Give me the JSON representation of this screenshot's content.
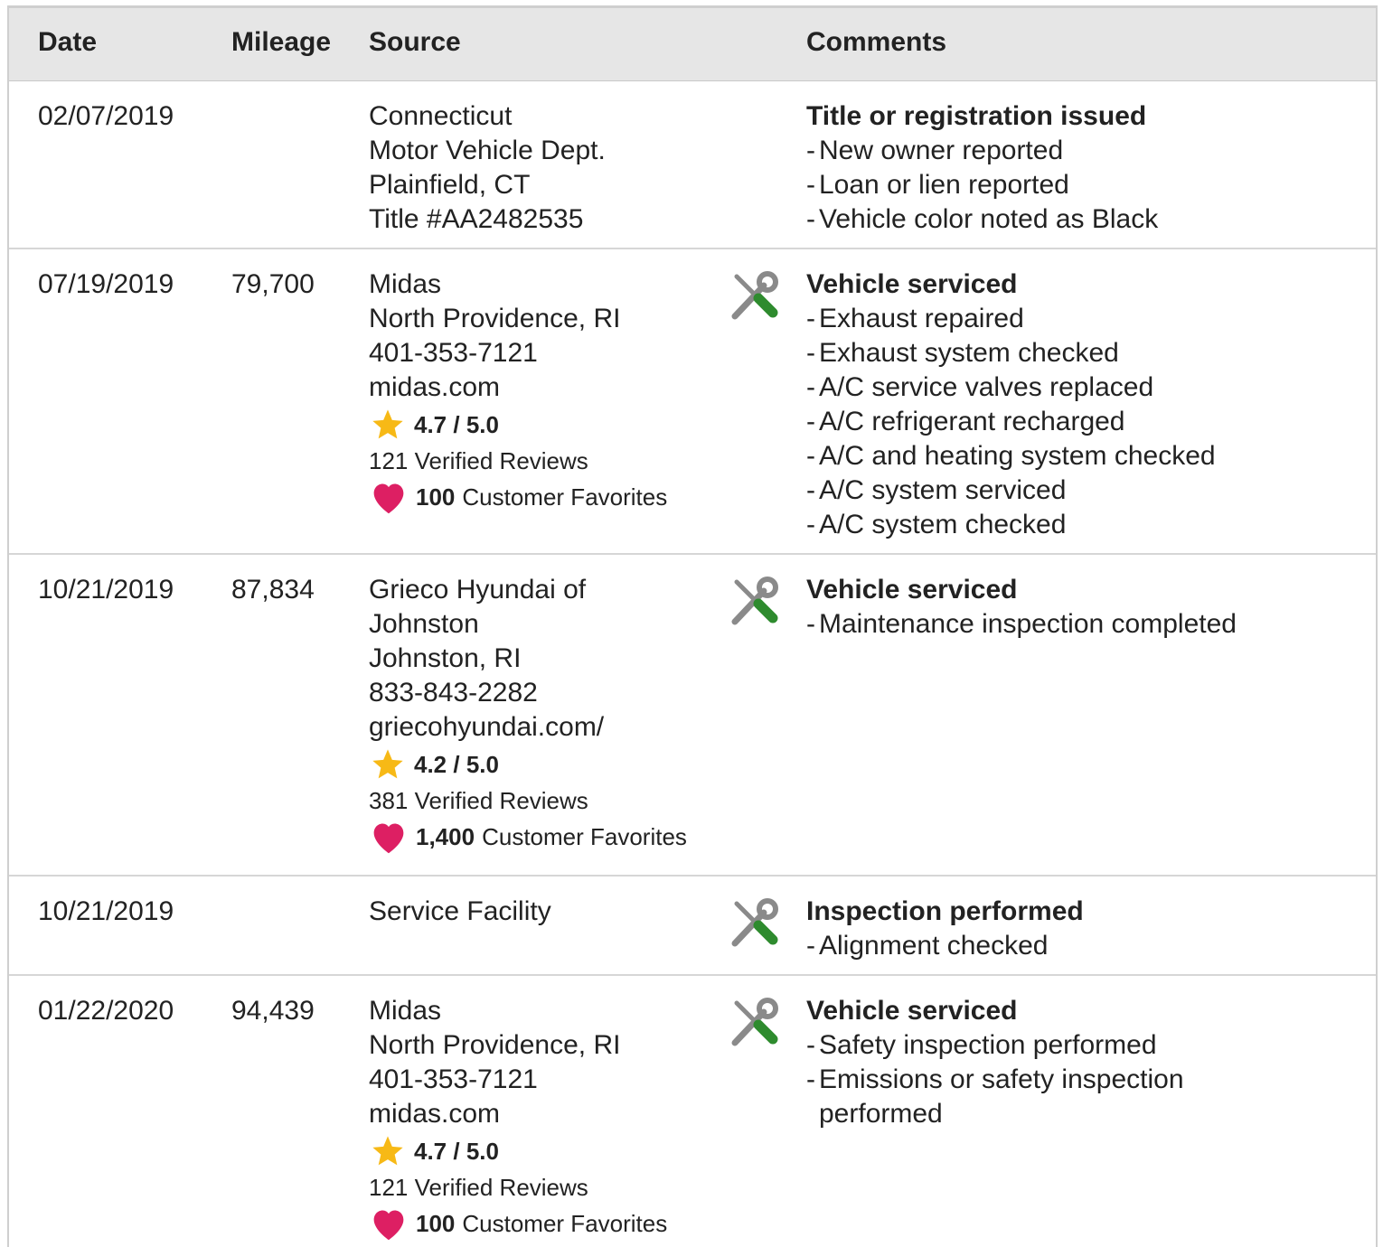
{
  "columns": {
    "date": "Date",
    "mileage": "Mileage",
    "source": "Source",
    "comments": "Comments"
  },
  "colors": {
    "header_bg": "#e6e6e6",
    "star": "#f7b916",
    "heart": "#dd1f63",
    "wrench_gray": "#8a8a8a",
    "screwdriver_green": "#2e8b2e"
  },
  "rows": [
    {
      "date": "02/07/2019",
      "mileage": "",
      "source_lines": [
        "Connecticut",
        "Motor Vehicle Dept.",
        "Plainfield, CT",
        "Title #AA2482535"
      ],
      "icon": "",
      "comment_title": "Title or registration issued",
      "comment_items": [
        "New owner reported",
        "Loan or lien reported",
        "Vehicle color noted as Black"
      ]
    },
    {
      "date": "07/19/2019",
      "mileage": "79,700",
      "source_lines": [
        "Midas",
        "North Providence, RI",
        "401-353-7121",
        "midas.com"
      ],
      "rating": "4.7 / 5.0",
      "reviews": "121 Verified Reviews",
      "favorites_count": "100",
      "favorites_label": "Customer Favorites",
      "icon": "wrench-screwdriver-icon",
      "comment_title": "Vehicle serviced",
      "comment_items": [
        "Exhaust repaired",
        "Exhaust system checked",
        "A/C service valves replaced",
        "A/C refrigerant recharged",
        "A/C and heating system checked",
        "A/C system serviced",
        "A/C system checked"
      ]
    },
    {
      "date": "10/21/2019",
      "mileage": "87,834",
      "source_lines": [
        "Grieco Hyundai of",
        "Johnston",
        "Johnston, RI",
        "833-843-2282",
        "griecohyundai.com/"
      ],
      "rating": "4.2 / 5.0",
      "reviews": "381 Verified Reviews",
      "favorites_count": "1,400",
      "favorites_label": "Customer Favorites",
      "icon": "wrench-screwdriver-icon",
      "comment_title": "Vehicle serviced",
      "comment_items": [
        "Maintenance inspection completed"
      ]
    },
    {
      "date": "10/21/2019",
      "mileage": "",
      "source_lines": [
        "Service Facility"
      ],
      "icon": "wrench-screwdriver-icon",
      "comment_title": "Inspection performed",
      "comment_items": [
        "Alignment checked"
      ]
    },
    {
      "date": "01/22/2020",
      "mileage": "94,439",
      "source_lines": [
        "Midas",
        "North Providence, RI",
        "401-353-7121",
        "midas.com"
      ],
      "rating": "4.7 / 5.0",
      "reviews": "121 Verified Reviews",
      "favorites_count": "100",
      "favorites_label": "Customer Favorites",
      "icon": "wrench-screwdriver-icon",
      "comment_title": "Vehicle serviced",
      "comment_items": [
        "Safety inspection performed",
        "Emissions or safety inspection performed"
      ]
    }
  ]
}
